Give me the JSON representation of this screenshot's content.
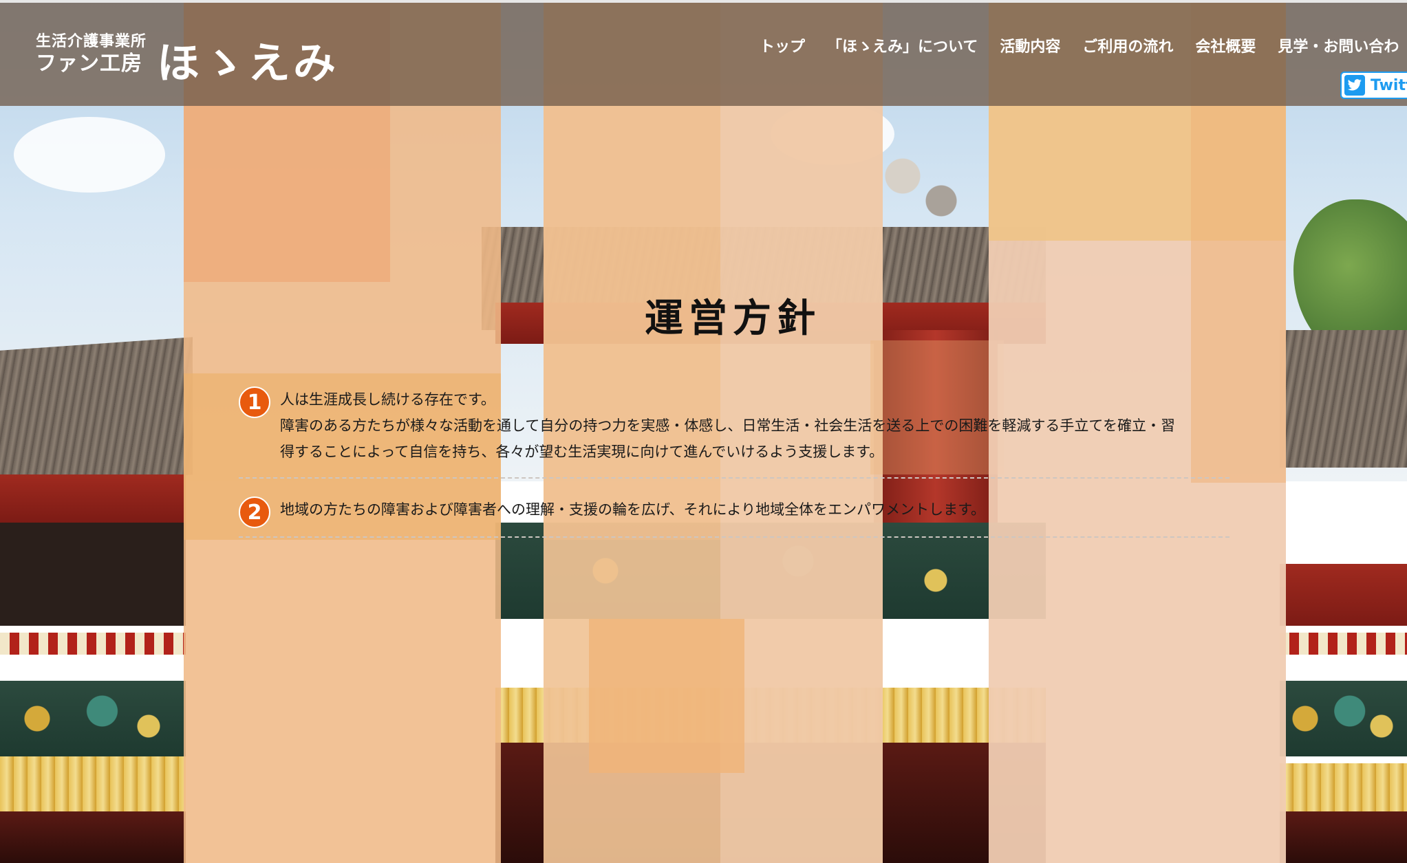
{
  "header": {
    "logo_sub": "生活介護事業所",
    "logo_name": "ファン工房",
    "logo_big": "ほゝえみ",
    "nav": [
      {
        "label": "トップ"
      },
      {
        "label": "「ほゝえみ」について"
      },
      {
        "label": "活動内容"
      },
      {
        "label": "ご利用の流れ"
      },
      {
        "label": "会社概要"
      },
      {
        "label": "見学・お問い合わ"
      }
    ],
    "twitter_label": "Twitt",
    "twitter_icon": "twitter-bird-icon"
  },
  "main": {
    "title": "運営方針",
    "policies": [
      {
        "number": "1",
        "lines": [
          "人は生涯成長し続ける存在です。",
          "障害のある方たちが様々な活動を通して自分の持つ力を実感・体感し、日常生活・社会生活を送る上での困難を軽減する手立てを確立・習",
          "得することによって自信を持ち、各々が望む生活実現に向けて進んでいけるよう支援します。"
        ]
      },
      {
        "number": "2",
        "lines": [
          "地域の方たちの障害および障害者への理解・支援の輪を広げ、それにより地域全体をエンパワメントします。"
        ]
      }
    ]
  },
  "colors": {
    "header_bg": "#715c4c",
    "accent_orange": "#e85a0e",
    "twitter_blue": "#1d9bf0",
    "panel_peach": "#f0c8a3",
    "panel_orange": "#efb380"
  }
}
